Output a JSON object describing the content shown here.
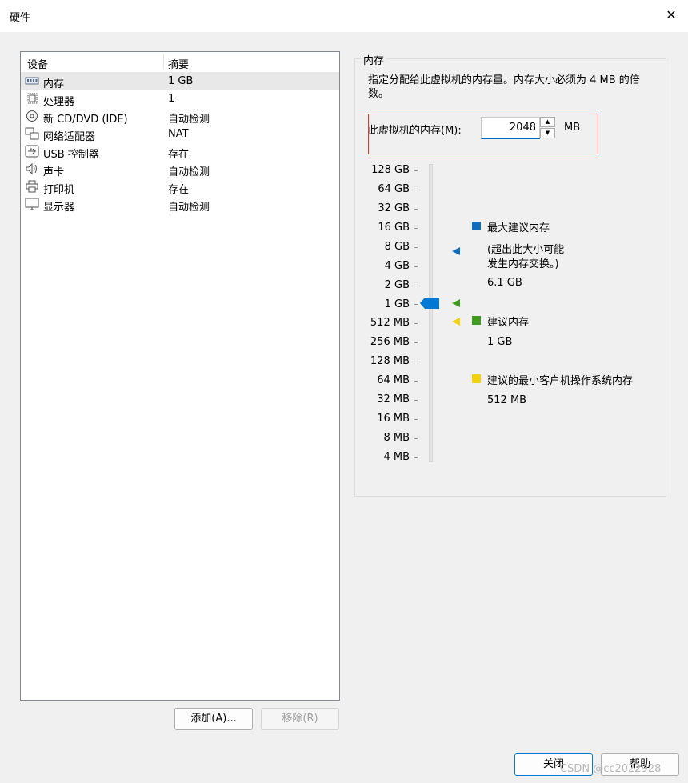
{
  "window": {
    "title": "硬件",
    "close_glyph": "✕"
  },
  "device_list": {
    "columns": [
      "设备",
      "摘要"
    ],
    "rows": [
      {
        "icon": "memory-icon",
        "name": "内存",
        "summary": "1 GB",
        "selected": true
      },
      {
        "icon": "processor-icon",
        "name": "处理器",
        "summary": "1"
      },
      {
        "icon": "cd-dvd-icon",
        "name": "新 CD/DVD (IDE)",
        "summary": "自动检测"
      },
      {
        "icon": "network-adapter-icon",
        "name": "网络适配器",
        "summary": "NAT"
      },
      {
        "icon": "usb-icon",
        "name": "USB 控制器",
        "summary": "存在"
      },
      {
        "icon": "speaker-icon",
        "name": "声卡",
        "summary": "自动检测"
      },
      {
        "icon": "printer-icon",
        "name": "打印机",
        "summary": "存在"
      },
      {
        "icon": "monitor-icon",
        "name": "显示器",
        "summary": "自动检测"
      }
    ]
  },
  "buttons": {
    "add": "添加(A)...",
    "remove": "移除(R)",
    "close": "关闭",
    "help": "帮助"
  },
  "memory": {
    "group_title": "内存",
    "description": "指定分配给此虚拟机的内存量。内存大小必须为 4 MB 的倍数。",
    "field_label": "此虚拟机的内存(M):",
    "value": "2048",
    "unit": "MB",
    "scale": [
      "128 GB",
      "64 GB",
      "32 GB",
      "16 GB",
      "8 GB",
      "4 GB",
      "2 GB",
      "1 GB",
      "512 MB",
      "256 MB",
      "128 MB",
      "64 MB",
      "32 MB",
      "16 MB",
      "8 MB",
      "4 MB"
    ],
    "legend": {
      "max_label": "最大建议内存",
      "max_note_1": "(超出此大小可能",
      "max_note_2": "发生内存交换。)",
      "max_value": "6.1 GB",
      "rec_label": "建议内存",
      "rec_value": "1 GB",
      "min_label": "建议的最小客户机操作系统内存",
      "min_value": "512 MB"
    }
  },
  "colors": {
    "max": "#0f6cbd",
    "recommended": "#3f9a1e",
    "minimum": "#f2d20c",
    "thumb": "#0078d4",
    "highlight_box": "#e03030"
  },
  "watermark": "CSDN @cc2022928"
}
